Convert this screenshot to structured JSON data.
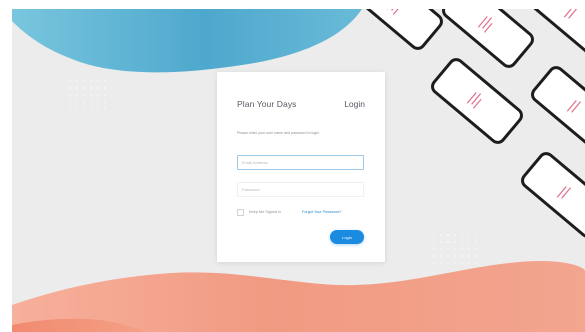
{
  "app_title": "Plan Your Days",
  "login_heading": "Login",
  "instructions": "Please enter your user name and password to login",
  "email_field": {
    "placeholder": "Email Address",
    "value": ""
  },
  "password_field": {
    "placeholder": "Password",
    "value": ""
  },
  "keep_signed_in": {
    "label": "Keep Me Signed In",
    "checked": false
  },
  "forgot_password_link": "Forgot Your Password?",
  "login_button": "Login",
  "colors": {
    "background": "#ececec",
    "top_wave": "#5ab3d4",
    "bottom_wave": "#f19a82",
    "accent": "#1b8be0",
    "link": "#2e86c9"
  }
}
